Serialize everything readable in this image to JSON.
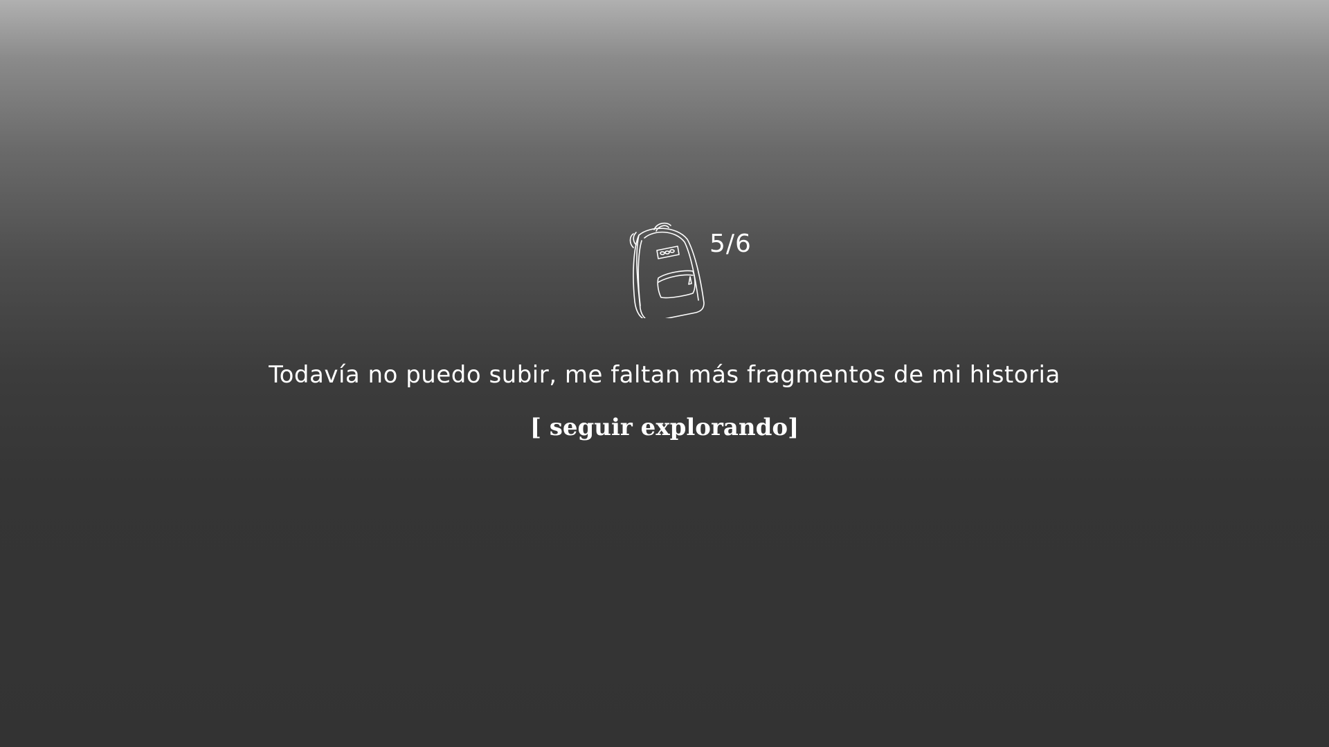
{
  "inventory": {
    "icon": "backpack-icon",
    "fragments_collected": "5/6"
  },
  "dialogue": {
    "message": "Todavía no puedo subir, me faltan más fragmentos de mi historia"
  },
  "actions": {
    "continue_label": "[ seguir explorando]"
  }
}
